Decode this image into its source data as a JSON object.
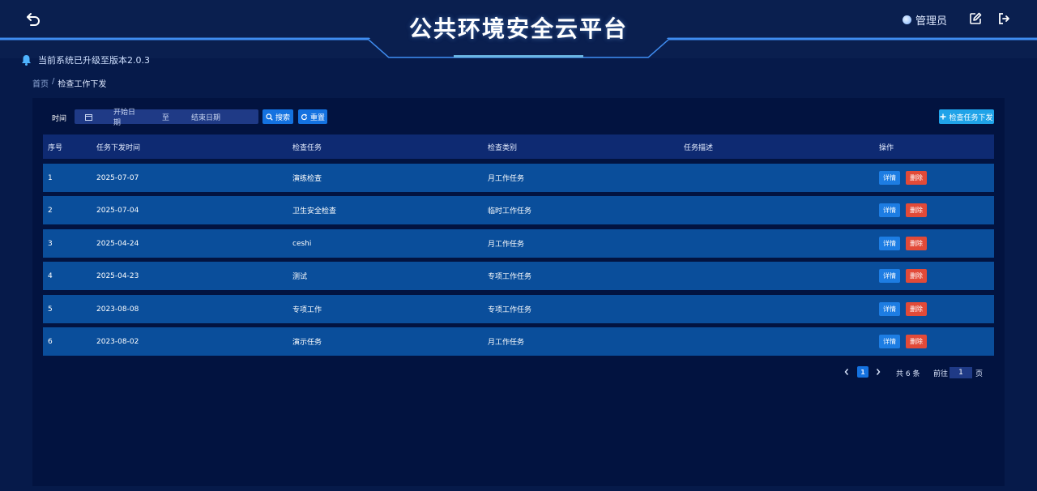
{
  "header": {
    "title": "公共环境安全云平台",
    "user_name": "管理员"
  },
  "notice": {
    "text": "当前系统已升级至版本2.0.3"
  },
  "breadcrumb": {
    "home": "首页",
    "separator": "/",
    "current": "检查工作下发"
  },
  "filter": {
    "time_label": "时间",
    "start_placeholder": "开始日期",
    "range_separator": "至",
    "end_placeholder": "结束日期",
    "search_label": "搜索",
    "reset_label": "重置",
    "add_label": "检查任务下发"
  },
  "table": {
    "columns": {
      "no": "序号",
      "date": "任务下发时间",
      "task": "检查任务",
      "category": "检查类别",
      "description": "任务描述",
      "operation": "操作"
    },
    "detail_label": "详情",
    "delete_label": "删除",
    "rows": [
      {
        "no": "1",
        "date": "2025-07-07",
        "task": "演练检查",
        "category": "月工作任务",
        "description": ""
      },
      {
        "no": "2",
        "date": "2025-07-04",
        "task": "卫生安全检查",
        "category": "临时工作任务",
        "description": ""
      },
      {
        "no": "3",
        "date": "2025-04-24",
        "task": "ceshi",
        "category": "月工作任务",
        "description": ""
      },
      {
        "no": "4",
        "date": "2025-04-23",
        "task": "测试",
        "category": "专项工作任务",
        "description": ""
      },
      {
        "no": "5",
        "date": "2023-08-08",
        "task": "专项工作",
        "category": "专项工作任务",
        "description": ""
      },
      {
        "no": "6",
        "date": "2023-08-02",
        "task": "演示任务",
        "category": "月工作任务",
        "description": ""
      }
    ]
  },
  "pagination": {
    "current_page": "1",
    "total_text": "共 6 条",
    "goto_label": "前往",
    "goto_value": "1",
    "page_unit": "页"
  },
  "colors": {
    "background": "#061a4a",
    "panel": "#021340",
    "row": "#0a4e9b",
    "header_row": "#0e2a72",
    "primary_button": "#1472e0",
    "danger_button": "#e24a38",
    "accent_line": "#3f8cf0"
  },
  "icons": {
    "back": "back-arrow-icon",
    "user": "user-dot-icon",
    "edit": "edit-icon",
    "logout": "logout-icon",
    "bell": "bell-icon",
    "calendar": "calendar-icon",
    "search": "search-icon",
    "reset": "refresh-icon",
    "add": "plus-icon"
  }
}
